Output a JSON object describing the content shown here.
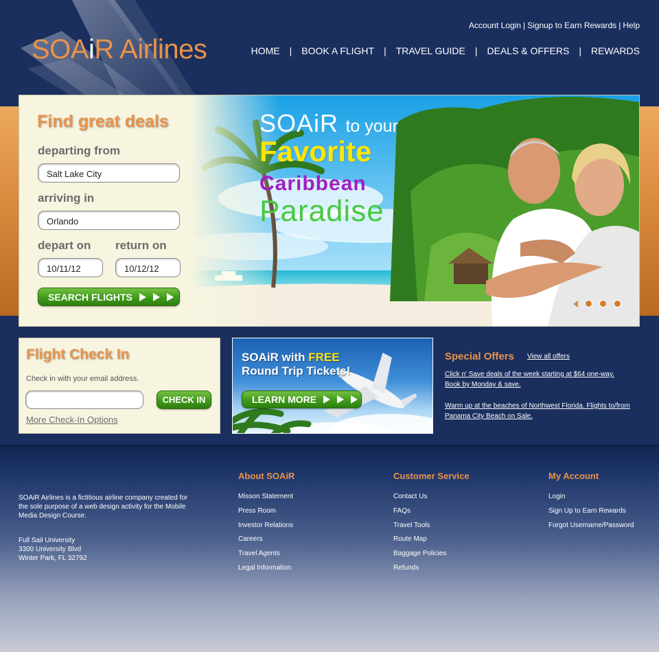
{
  "brand": {
    "logo_prefix": "SOA",
    "logo_i": "i",
    "logo_suffix": "R Airlines",
    "accent_color": "#e9934a",
    "navy_color": "#1a2f5e",
    "green_color": "#3f9a1b"
  },
  "top_links": [
    "Account Login",
    "Signup to Earn Rewards",
    "Help"
  ],
  "nav": [
    "HOME",
    "BOOK A FLIGHT",
    "TRAVEL GUIDE",
    "DEALS & OFFERS",
    "REWARDS"
  ],
  "search": {
    "title": "Find great deals",
    "departing_label": "departing from",
    "departing_value": "Salt Lake City",
    "arriving_label": "arriving in",
    "arriving_value": "Orlando",
    "depart_label": "depart on",
    "depart_value": "10/11/12",
    "return_label": "return on",
    "return_value": "10/12/12",
    "button_label": "SEARCH FLIGHTS"
  },
  "hero": {
    "line1a": "SOAiR",
    "line1b": "to your",
    "line2": "Favorite",
    "line3": "Caribbean",
    "line4": "Paradise"
  },
  "checkin": {
    "title": "Flight Check In",
    "description": "Check in with your email address.",
    "email_value": "",
    "button_label": "CHECK IN",
    "more_link": "More Check-In Options"
  },
  "promo": {
    "line1_a": "SOAiR with ",
    "line1_b": "FREE",
    "line2": "Round Trip Tickets!",
    "button_label": "LEARN MORE"
  },
  "offers": {
    "title": "Special Offers",
    "view_all": "View all offers",
    "items": [
      "Click n' Save deals of the week starting at $64 one-way. Book by Monday & save.",
      "Warm up at the beaches of Northwest Florida. Flights to/from Panama City Beach on Sale."
    ]
  },
  "footer": {
    "about": "SOAiR Airlines is a fictitious airline company created for the sole purpose of a web design activity for the Mobile Media Design Course.",
    "address": [
      "Full Sail University",
      "3300 University Blvd",
      "Winter Park, FL 32792"
    ],
    "columns": [
      {
        "title": "About SOAiR",
        "links": [
          "Misson Statement",
          "Press Room",
          "Investor Relations",
          "Careers",
          "Travel Agents",
          "Legal Information"
        ]
      },
      {
        "title": "Customer Service",
        "links": [
          "Contact Us",
          "FAQs",
          "Travel Tools",
          "Route Map",
          "Baggage Policies",
          "Refunds"
        ]
      },
      {
        "title": "My Account",
        "links": [
          "Login",
          "Sign Up to Earn Rewards",
          "Forgot Username/Password"
        ]
      }
    ]
  },
  "icons": [
    "arrow-right-icon",
    "carousel-dot-icon",
    "carousel-prev-icon",
    "airplane-icon",
    "palm-tree-icon"
  ]
}
